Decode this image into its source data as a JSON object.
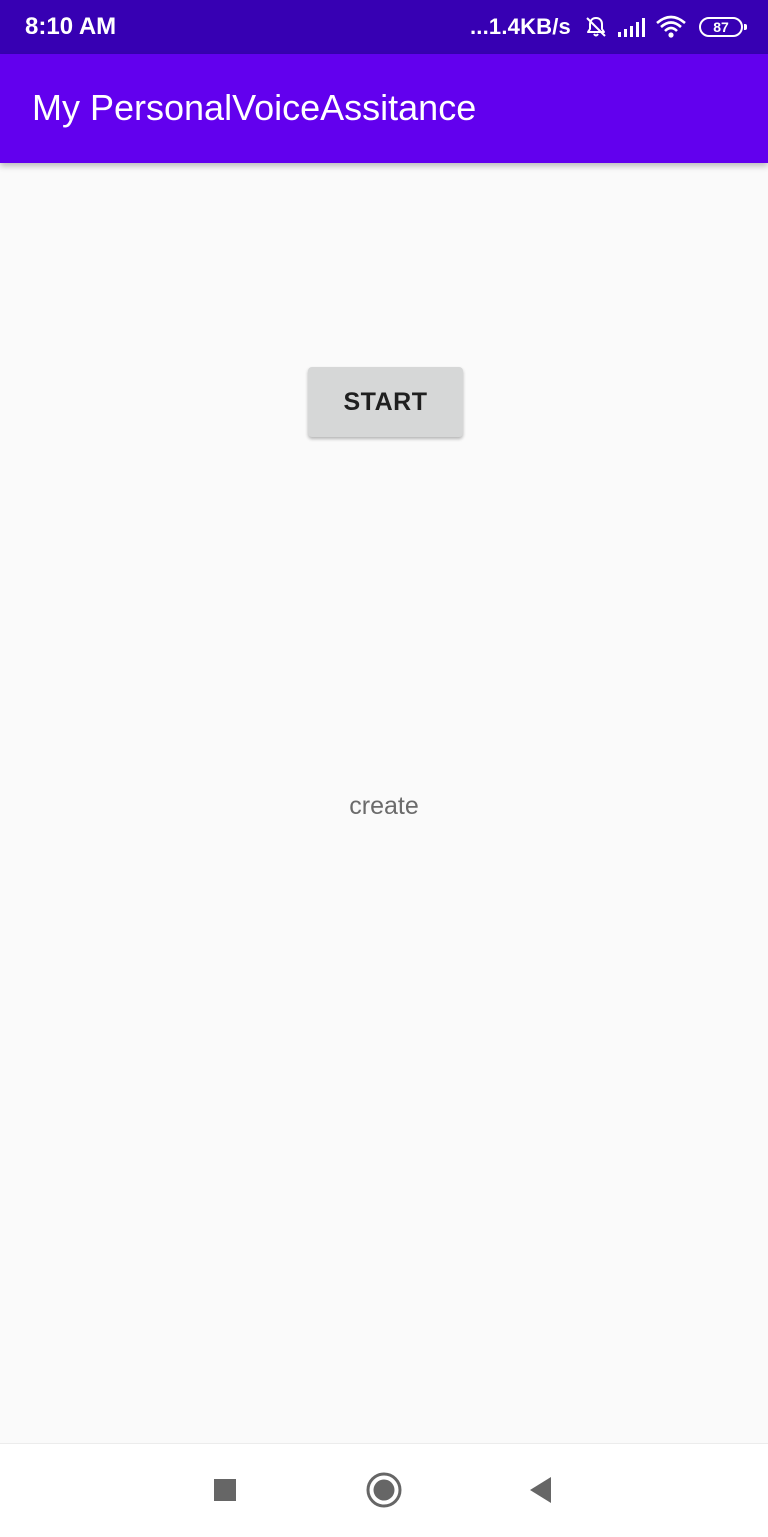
{
  "status_bar": {
    "time": "8:10 AM",
    "network_speed": "...1.4KB/s",
    "battery_level": "87",
    "icons": [
      "bell-off-icon",
      "cellular-signal-icon",
      "wifi-icon",
      "battery-icon"
    ]
  },
  "app_bar": {
    "title": "My PersonalVoiceAssitance"
  },
  "main": {
    "start_button_label": "START",
    "status_text": "create"
  },
  "nav_bar": {
    "buttons": [
      "recent-apps-button",
      "home-button",
      "back-button"
    ]
  },
  "colors": {
    "status_bar": "#3700b3",
    "app_bar": "#6200ee",
    "background": "#fafafa",
    "button": "#d6d7d7",
    "status_text": "#6b6b6b",
    "nav_icons": "#666666"
  }
}
